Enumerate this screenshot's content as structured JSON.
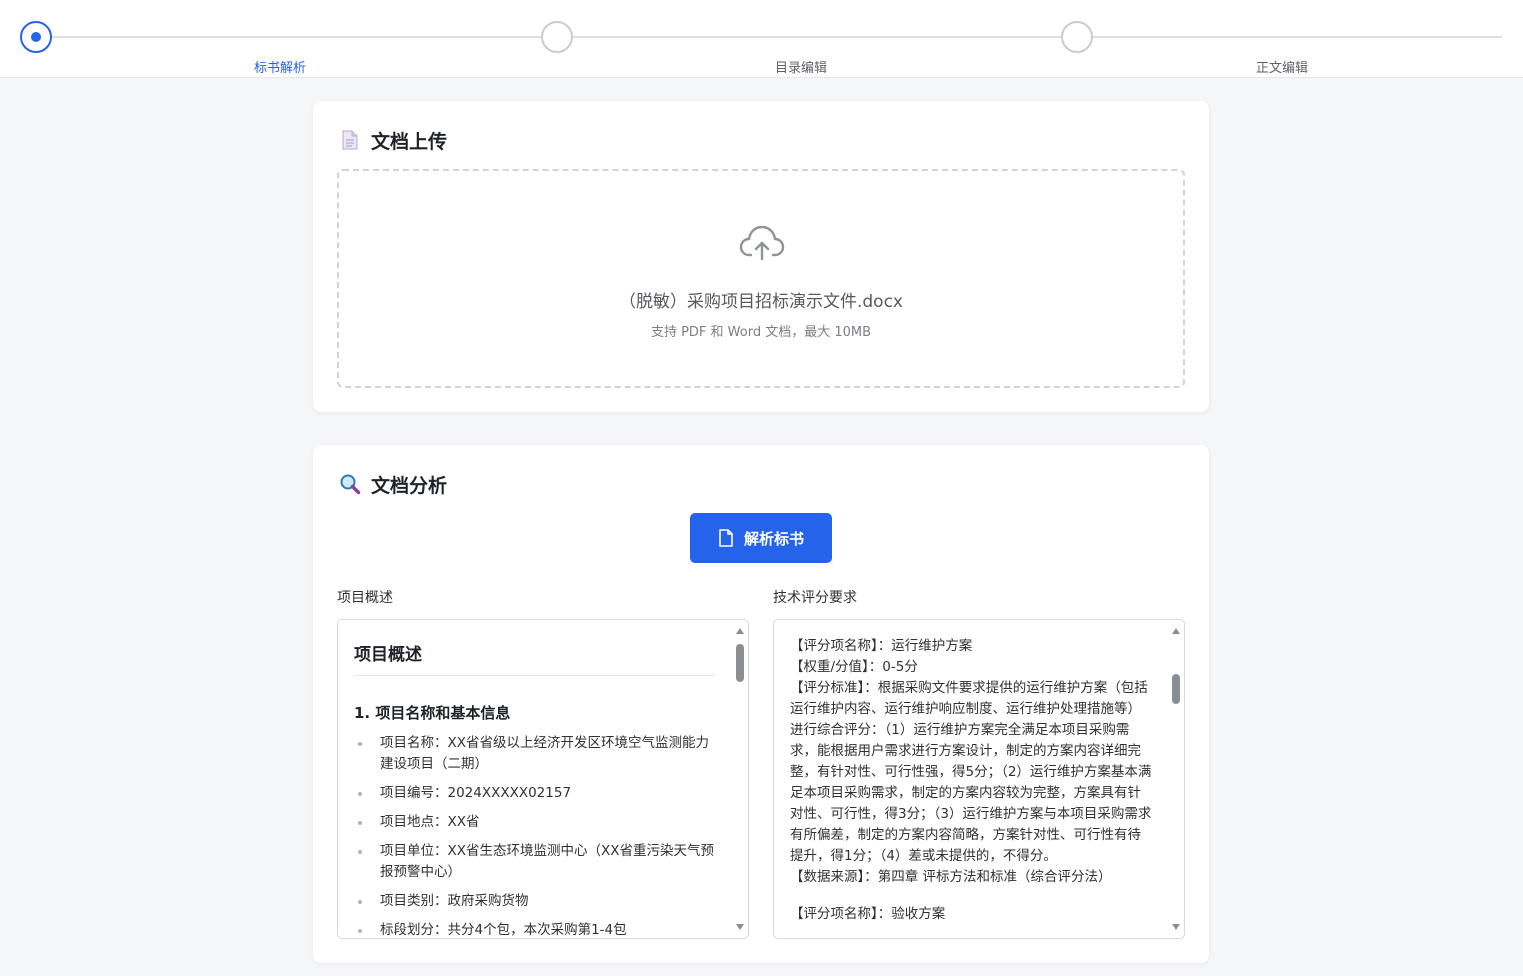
{
  "steps": [
    {
      "label": "标书解析",
      "active": true
    },
    {
      "label": "目录编辑",
      "active": false
    },
    {
      "label": "正文编辑",
      "active": false
    }
  ],
  "upload": {
    "title": "文档上传",
    "file_name": "（脱敏）采购项目招标演示文件.docx",
    "hint": "支持 PDF 和 Word 文档，最大 10MB"
  },
  "analysis": {
    "title": "文档分析",
    "parse_button": "解析标书",
    "overview_label": "项目概述",
    "tech_label": "技术评分要求",
    "overview": {
      "heading": "项目概述",
      "section1": "1. 项目名称和基本信息",
      "items": [
        "项目名称：XX省省级以上经济开发区环境空气监测能力建设项目（二期）",
        "项目编号：2024XXXXX02157",
        "项目地点：XX省",
        "项目单位：XX省生态环境监测中心（XX省重污染天气预报预警中心）",
        "项目类别：政府采购货物",
        "标段划分：共分4个包，本次采购第1-4包"
      ]
    },
    "tech": {
      "item1_name": "【评分项名称】：运行维护方案",
      "item1_weight": "【权重/分值】：0-5分",
      "item1_criteria": "【评分标准】：根据采购文件要求提供的运行维护方案（包括运行维护内容、运行维护响应制度、运行维护处理措施等）进行综合评分：（1）运行维护方案完全满足本项目采购需求，能根据用户需求进行方案设计，制定的方案内容详细完整，有针对性、可行性强，得5分；（2）运行维护方案基本满足本项目采购需求，制定的方案内容较为完整，方案具有针对性、可行性，得3分；（3）运行维护方案与本项目采购需求有所偏差，制定的方案内容简略，方案针对性、可行性有待提升，得1分；（4）差或未提供的，不得分。",
      "item1_source": "【数据来源】：第四章 评标方法和标准（综合评分法）",
      "item2_name": "【评分项名称】：验收方案"
    }
  },
  "colors": {
    "primary": "#2563eb",
    "background": "#f5f6f8"
  },
  "icons": {
    "upload_title": "document-icon",
    "upload_zone": "cloud-upload-icon",
    "analysis_title": "magnifier-icon",
    "parse_button": "file-icon"
  }
}
